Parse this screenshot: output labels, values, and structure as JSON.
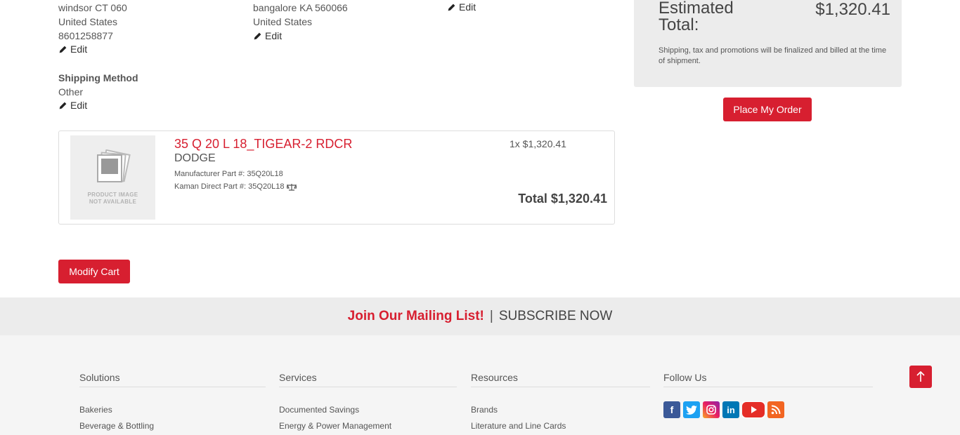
{
  "addresses": {
    "billing": {
      "city_line": "windsor  CT  060",
      "country": "United States",
      "phone": "8601258877",
      "edit_label": "Edit"
    },
    "shipping": {
      "city_line": "bangalore  KA  560066",
      "country": "United States",
      "edit_label": "Edit"
    },
    "payment": {
      "edit_label": "Edit"
    }
  },
  "shipping_method": {
    "heading": "Shipping Method",
    "value": "Other",
    "edit_label": "Edit"
  },
  "summary": {
    "estimated_label_1": "Estimated",
    "estimated_label_2": "Total:",
    "estimated_value": "$1,320.41",
    "note": "Shipping, tax and promotions will be finalized and billed at the time of shipment.",
    "place_order_label": "Place My Order"
  },
  "cart_item": {
    "image_text_1": "PRODUCT IMAGE",
    "image_text_2": "NOT AVAILABLE",
    "title": "35 Q 20 L 18_TIGEAR-2 RDCR",
    "brand": "DODGE",
    "manufacturer_part": "Manufacturer Part #: 35Q20L18",
    "kaman_part": "Kaman Direct Part #: 35Q20L18",
    "qty_price": "1x $1,320.41",
    "total": "Total $1,320.41"
  },
  "modify_cart_label": "Modify Cart",
  "mailing": {
    "join": "Join Our Mailing List!",
    "separator": "|",
    "subscribe": "SUBSCRIBE NOW"
  },
  "footer": {
    "solutions": {
      "heading": "Solutions",
      "links": [
        "Bakeries",
        "Beverage & Bottling"
      ]
    },
    "services": {
      "heading": "Services",
      "links": [
        "Documented Savings",
        "Energy & Power Management"
      ]
    },
    "resources": {
      "heading": "Resources",
      "links": [
        "Brands",
        "Literature and Line Cards"
      ]
    },
    "follow": {
      "heading": "Follow Us"
    },
    "social_icons": [
      "facebook-icon",
      "twitter-icon",
      "instagram-icon",
      "linkedin-icon",
      "youtube-icon",
      "rss-icon"
    ]
  },
  "colors": {
    "brand_red": "#d71f30",
    "panel_gray": "#ececec",
    "footer_bg": "#f5f5f5"
  }
}
